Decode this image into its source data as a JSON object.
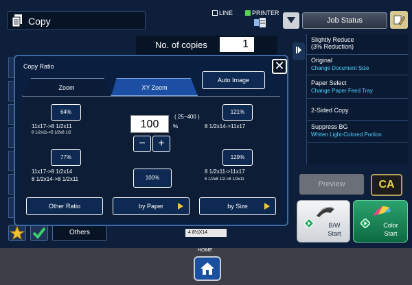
{
  "header": {
    "mode_title": "Copy",
    "line_status": "LINE",
    "printer_status": "PRINTER",
    "job_status_label": "Job Status"
  },
  "copies": {
    "label": "No. of copies",
    "value": "1"
  },
  "right_panel": {
    "items": [
      {
        "title": "Slightly Reduce",
        "subtitle": "(3% Reduction)"
      },
      {
        "title": "Original",
        "action": "Change Document Size"
      },
      {
        "title": "Paper Select",
        "action": "Change Paper Feed Tray"
      },
      {
        "title": "2-Sided Copy"
      },
      {
        "title": "Suppress BG",
        "action": "Whiten Light-Colored Portion"
      }
    ]
  },
  "actions": {
    "preview": "Preview",
    "ca": "CA",
    "bw_start": "B/W\nStart",
    "color_start": "Color\nStart",
    "others": "Others"
  },
  "tray_indicator": "4  8½X14",
  "dialog": {
    "title": "Copy Ratio",
    "close": "✕",
    "auto_image": "Auto Image",
    "tabs": [
      {
        "label": "Zoom"
      },
      {
        "label": "XY Zoom",
        "active": true
      }
    ],
    "zoom_value": "100",
    "zoom_range": "( 25~400 )",
    "zoom_unit": "%",
    "presets": [
      {
        "pct": "64%",
        "line1": "11x17->8 1/2x11",
        "line2": "8 1/2x11->5 1/2x8 1/2"
      },
      {
        "pct": "77%",
        "line1": "11x17->8 1/2x14",
        "line2": "8 1/2x14->8 1/2x11"
      },
      {
        "pct": "121%",
        "line1": "8 1/2x14->11x17"
      },
      {
        "pct": "129%",
        "line1": "8 1/2x11->11x17",
        "line2": "5 1/2x8 1/2->8 1/2x11"
      }
    ],
    "reset": "100%",
    "minus": "−",
    "plus": "+",
    "other_ratio": "Other Ratio",
    "by_paper": "by Paper",
    "by_size": "by Size"
  },
  "home": {
    "label": "HOME"
  },
  "colors": {
    "accent_blue": "#1c4fa3",
    "ca_yellow": "#f0d24a",
    "start_green": "#1aa35c"
  }
}
